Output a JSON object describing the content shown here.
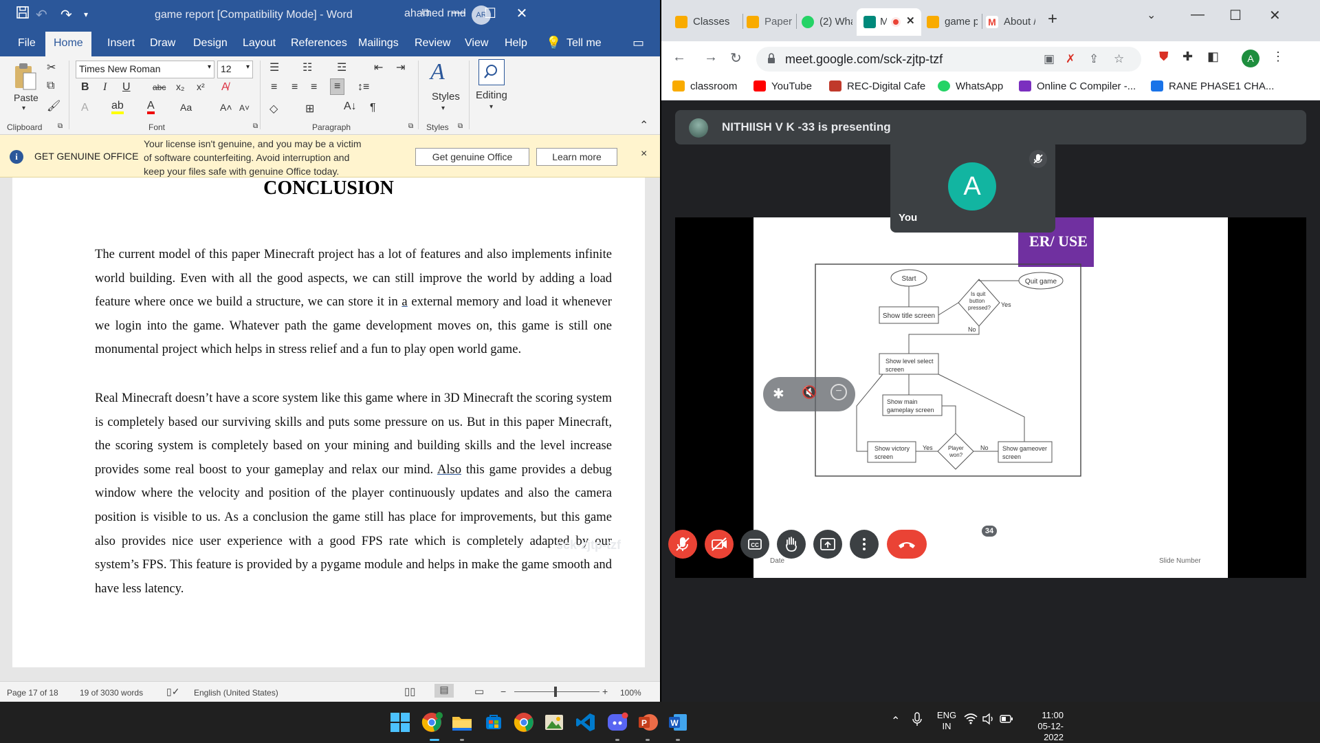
{
  "word": {
    "title": "game report [Compatibility Mode]  -  Word",
    "user": "ahamed rmd",
    "user_initials": "AR",
    "tabs": [
      "File",
      "Home",
      "Insert",
      "Draw",
      "Design",
      "Layout",
      "References",
      "Mailings",
      "Review",
      "View",
      "Help",
      "Tell me"
    ],
    "active_tab": "Home",
    "ribbon": {
      "font_name": "Times New Roman",
      "font_size": "12",
      "paste": "Paste",
      "styles": "Styles",
      "editing": "Editing",
      "groups": [
        "Clipboard",
        "Font",
        "Paragraph",
        "Styles"
      ]
    },
    "genuine_bar": {
      "title": "GET GENUINE OFFICE",
      "message": "Your license isn't genuine, and you may be a victim of software counterfeiting. Avoid interruption and keep your files safe with genuine Office today.",
      "button_primary": "Get genuine Office",
      "button_secondary": "Learn more",
      "close": "×"
    },
    "document": {
      "heading": "CONCLUSION",
      "para1_a": "The current model of this paper Minecraft project has a lot of features and also implements infinite world building. Even with all the good aspects, we can still improve the world by adding a load feature where once we build a structure, we can store it in ",
      "para1_u": "a",
      "para1_b": " external memory and load it whenever we login into the game. Whatever path the game development moves on, this game is still one monumental project which helps in stress relief and a fun to play open world game.",
      "para2_a": "Real Minecraft doesn’t have a score system like this game where in 3D Minecraft the scoring system is completely based our surviving skills and puts some pressure on us. But in this paper Minecraft, the scoring system is completely based on your mining and building skills and the level increase provides some real boost to your gameplay and relax our mind. ",
      "para2_u": "Also",
      "para2_b": " this game provides a debug window where the velocity and position of the player continuously updates and also the camera position is visible to us. As a conclusion the game still has place for improvements, but this game also provides nice user experience with a good FPS rate which is completely adapted by our system’s FPS. This feature is provided by a pygame module and helps in make the game smooth and have less latency."
    },
    "status": {
      "page": "Page 17 of 18",
      "words": "19 of 3030 words",
      "language": "English (United States)",
      "zoom": "100%"
    }
  },
  "chrome": {
    "tabs": [
      {
        "label": "Classes",
        "color": "#f9ab00"
      },
      {
        "label": "Paper M",
        "color": "#f9ab00"
      },
      {
        "label": "(2) Wha",
        "color": "#25d366"
      },
      {
        "label": "M",
        "color": "#00897b"
      },
      {
        "label": "game p",
        "color": "#f9ab00"
      },
      {
        "label": "About /",
        "color": "#ea4335"
      }
    ],
    "url": "meet.google.com/sck-zjtp-tzf",
    "profile_initial": "A",
    "bookmarks": [
      {
        "label": "classroom",
        "color": "#f9ab00"
      },
      {
        "label": "YouTube",
        "color": "#ff0000"
      },
      {
        "label": "REC-Digital Cafe",
        "color": "#c0392b"
      },
      {
        "label": "WhatsApp",
        "color": "#25d366"
      },
      {
        "label": "Online C Compiler -...",
        "color": "#7b2fbf"
      },
      {
        "label": "RANE PHASE1 CHA...",
        "color": "#1a73e8"
      }
    ]
  },
  "meet": {
    "presenter": "NITHIISH V K -33 is presenting",
    "self_label": "You",
    "self_initial": "A",
    "meeting_code": "sck-zjtp-tzf",
    "participants": "34",
    "slide": {
      "title_fragment": "ER/ USE",
      "footer_left": "Date",
      "footer_right": "Slide Number",
      "nodes": {
        "start": "Start",
        "quit": "Quit game",
        "quit_q1": "Is quit",
        "quit_q2": "button",
        "quit_q3": "pressed?",
        "yes": "Yes",
        "no": "No",
        "title_screen": "Show title screen",
        "level1": "Show level select",
        "level2": "screen",
        "main1": "Show main",
        "main2": "gameplay screen",
        "victory1": "Show victory",
        "victory2": "screen",
        "won1": "Player",
        "won2": "won?",
        "gameover1": "Show gameover",
        "gameover2": "screen"
      }
    }
  },
  "taskbar": {
    "lang1": "ENG",
    "lang2": "IN",
    "time": "11:00",
    "date": "05-12-2022"
  }
}
